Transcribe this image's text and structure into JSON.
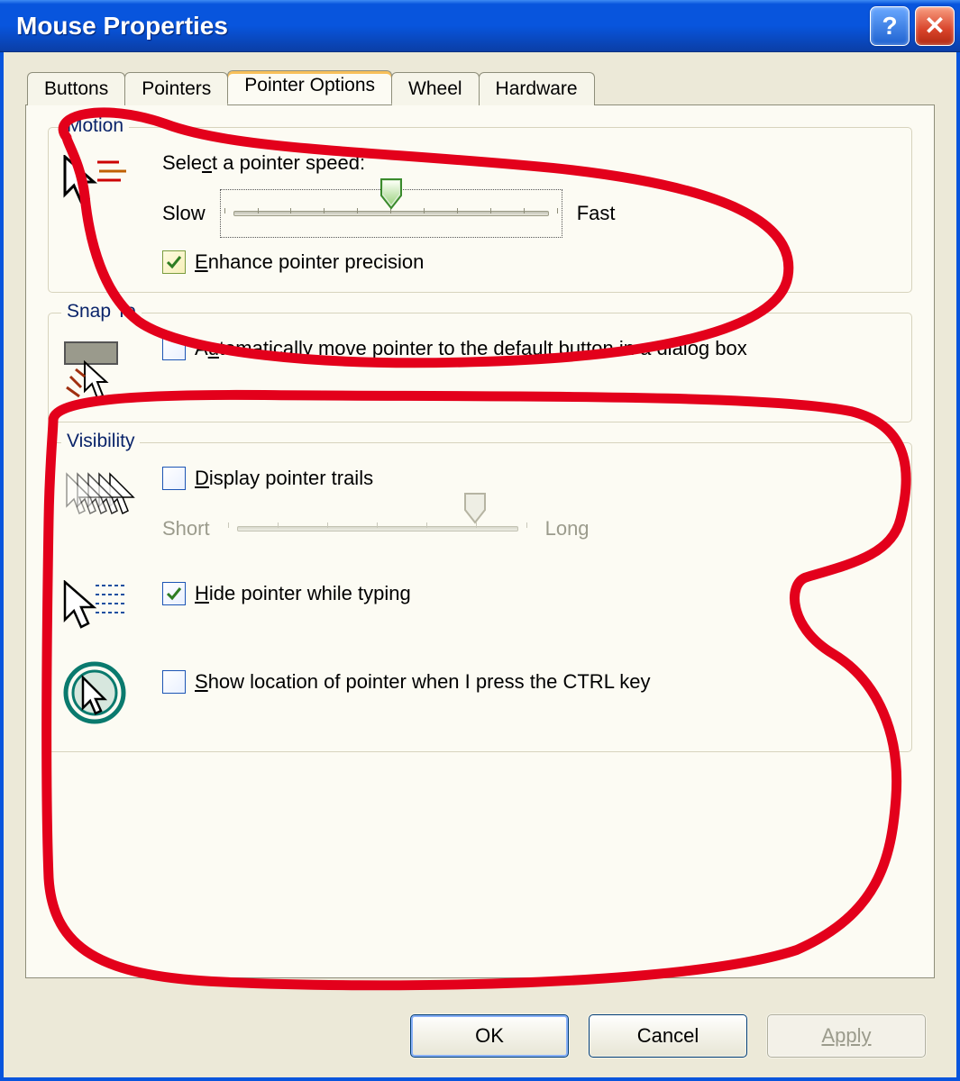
{
  "window": {
    "title": "Mouse Properties",
    "help_tooltip": "?",
    "close_tooltip": "X"
  },
  "tabs": [
    {
      "label": "Buttons",
      "active": false
    },
    {
      "label": "Pointers",
      "active": false
    },
    {
      "label": "Pointer Options",
      "active": true
    },
    {
      "label": "Wheel",
      "active": false
    },
    {
      "label": "Hardware",
      "active": false
    }
  ],
  "motion": {
    "title": "Motion",
    "speed_label": "Select a pointer speed:",
    "slow": "Slow",
    "fast": "Fast",
    "slider": {
      "min": 1,
      "max": 11,
      "value": 6
    },
    "enhance": {
      "label": "Enhance pointer precision",
      "checked": true
    }
  },
  "snap": {
    "title": "Snap To",
    "auto": {
      "label": "Automatically move pointer to the default button in a dialog box",
      "checked": false
    }
  },
  "visibility": {
    "title": "Visibility",
    "trails": {
      "label": "Display pointer trails",
      "checked": false
    },
    "trails_short": "Short",
    "trails_long": "Long",
    "trails_slider": {
      "min": 1,
      "max": 7,
      "value": 6,
      "enabled": false
    },
    "hide": {
      "label": "Hide pointer while typing",
      "checked": true
    },
    "show": {
      "label": "Show location of pointer when I press the CTRL key",
      "checked": false
    }
  },
  "buttons": {
    "ok": "OK",
    "cancel": "Cancel",
    "apply": "Apply"
  }
}
